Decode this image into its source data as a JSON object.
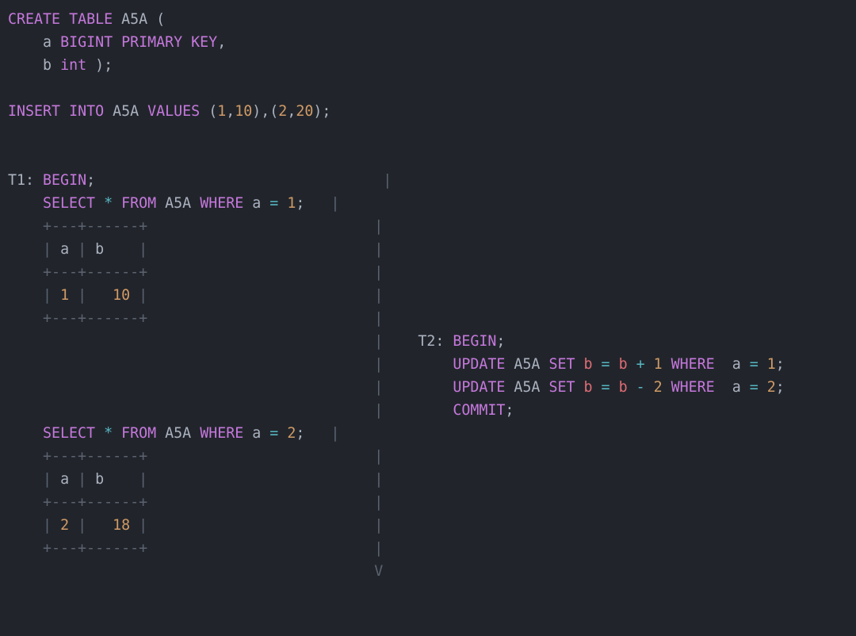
{
  "sql": {
    "create_table": {
      "kw_create": "CREATE",
      "kw_table": "TABLE",
      "name": "A5A",
      "col_a": "a",
      "type_a": "BIGINT",
      "pk": "PRIMARY KEY",
      "col_b": "b",
      "type_b": "int"
    },
    "insert": {
      "kw_insert": "INSERT",
      "kw_into": "INTO",
      "table": "A5A",
      "kw_values": "VALUES",
      "v1a": "1",
      "v1b": "10",
      "v2a": "2",
      "v2b": "20"
    },
    "t1": {
      "label": "T1:",
      "begin": "BEGIN",
      "select1": {
        "kw_select": "SELECT",
        "star": "*",
        "kw_from": "FROM",
        "table": "A5A",
        "kw_where": "WHERE",
        "col": "a",
        "eq": "=",
        "val": "1"
      },
      "result1": {
        "sep": "+---+------+",
        "hdr_a": "a",
        "hdr_b": "b",
        "row_a": "1",
        "row_b": "10"
      },
      "select2": {
        "kw_select": "SELECT",
        "star": "*",
        "kw_from": "FROM",
        "table": "A5A",
        "kw_where": "WHERE",
        "col": "a",
        "eq": "=",
        "val": "2"
      },
      "result2": {
        "sep": "+---+------+",
        "hdr_a": "a",
        "hdr_b": "b",
        "row_a": "2",
        "row_b": "18"
      }
    },
    "t2": {
      "label": "T2:",
      "begin": "BEGIN",
      "update1": {
        "kw_update": "UPDATE",
        "table": "A5A",
        "kw_set": "SET",
        "col_lhs": "b",
        "eq1": "=",
        "col_rhs": "b",
        "op": "+",
        "delta": "1",
        "kw_where": "WHERE",
        "wcol": "a",
        "eq2": "=",
        "wval": "1"
      },
      "update2": {
        "kw_update": "UPDATE",
        "table": "A5A",
        "kw_set": "SET",
        "col_lhs": "b",
        "eq1": "=",
        "col_rhs": "b",
        "op": "-",
        "delta": "2",
        "kw_where": "WHERE",
        "wcol": "a",
        "eq2": "=",
        "wval": "2"
      },
      "commit": "COMMIT"
    },
    "timeline_arrow": "V",
    "pipe": "|"
  }
}
